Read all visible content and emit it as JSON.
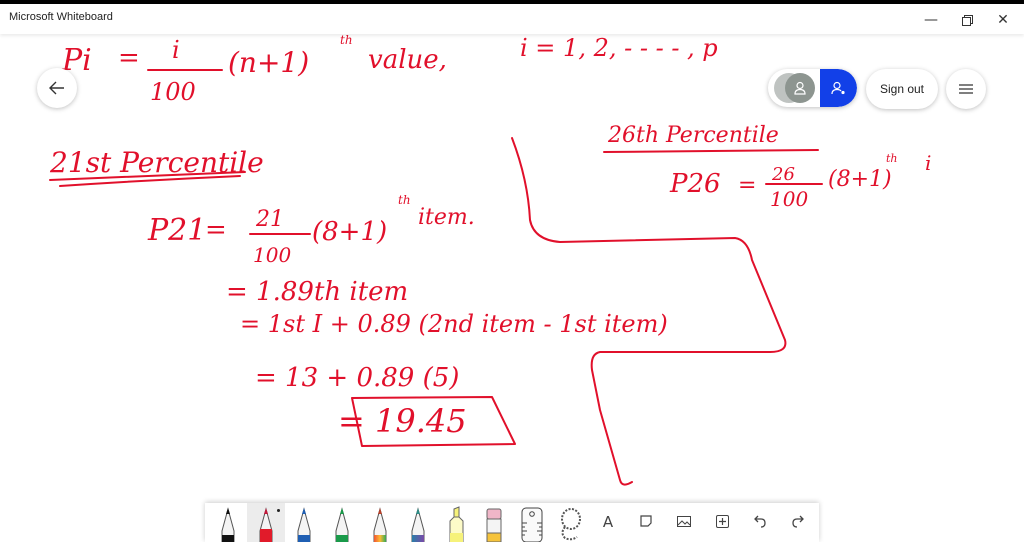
{
  "window": {
    "title": "Microsoft Whiteboard",
    "minimize_icon": "minimize-icon",
    "maximize_icon": "restore-icon",
    "close_icon": "close-icon"
  },
  "header": {
    "back_icon": "arrow-left-icon",
    "user_icon": "user-icon",
    "add_user_icon": "add-user-icon",
    "sign_out_label": "Sign out",
    "menu_icon": "hamburger-menu-icon",
    "accent_color": "#1240e8"
  },
  "ink": {
    "color": "#e1102b",
    "formula_line": {
      "lhs": "Pi",
      "eq": "=",
      "numerator": "i",
      "denominator": "100",
      "factor": "(n+1)",
      "superscript": "th",
      "word": "value,",
      "range": "i = 1, 2, - - - - , p"
    },
    "left_section": {
      "heading": "21st Percentile",
      "line1": {
        "lhs": "P21",
        "eq": "=",
        "numerator": "21",
        "denominator": "100",
        "factor": "(8+1)",
        "sup": "th",
        "word": "item."
      },
      "line2": "= 1.89th item",
      "line3": "= 1st I + 0.89 (2nd item - 1st item)",
      "line4": "= 13 + 0.89 (5)",
      "result": "= 19.45"
    },
    "right_section": {
      "heading": "26th Percentile",
      "line1": {
        "lhs": "P26",
        "eq": "=",
        "numerator": "26",
        "denominator": "100",
        "factor": "(8+1)",
        "sup": "th",
        "word": "i"
      }
    }
  },
  "toolbar": {
    "tools": [
      {
        "name": "black-pen",
        "color": "#111111"
      },
      {
        "name": "red-pen",
        "color": "#e11b2a",
        "active": true
      },
      {
        "name": "blue-pen",
        "color": "#1f5fb3"
      },
      {
        "name": "green-pen",
        "color": "#1a9a4a"
      },
      {
        "name": "rainbow-pen",
        "color": "#d8502a"
      },
      {
        "name": "galaxy-pen",
        "color": "#2f8c86"
      },
      {
        "name": "highlighter",
        "color": "#f6f27a"
      },
      {
        "name": "eraser",
        "color": "#f0b6c8"
      },
      {
        "name": "ruler",
        "glyph": ""
      },
      {
        "name": "lasso",
        "glyph": ""
      },
      {
        "name": "text",
        "glyph": "A"
      },
      {
        "name": "sticky-note",
        "glyph": "◻"
      },
      {
        "name": "image",
        "glyph": "▭"
      },
      {
        "name": "insert",
        "glyph": "⊞"
      },
      {
        "name": "undo",
        "glyph": "↶"
      },
      {
        "name": "redo",
        "glyph": "↷"
      }
    ]
  }
}
